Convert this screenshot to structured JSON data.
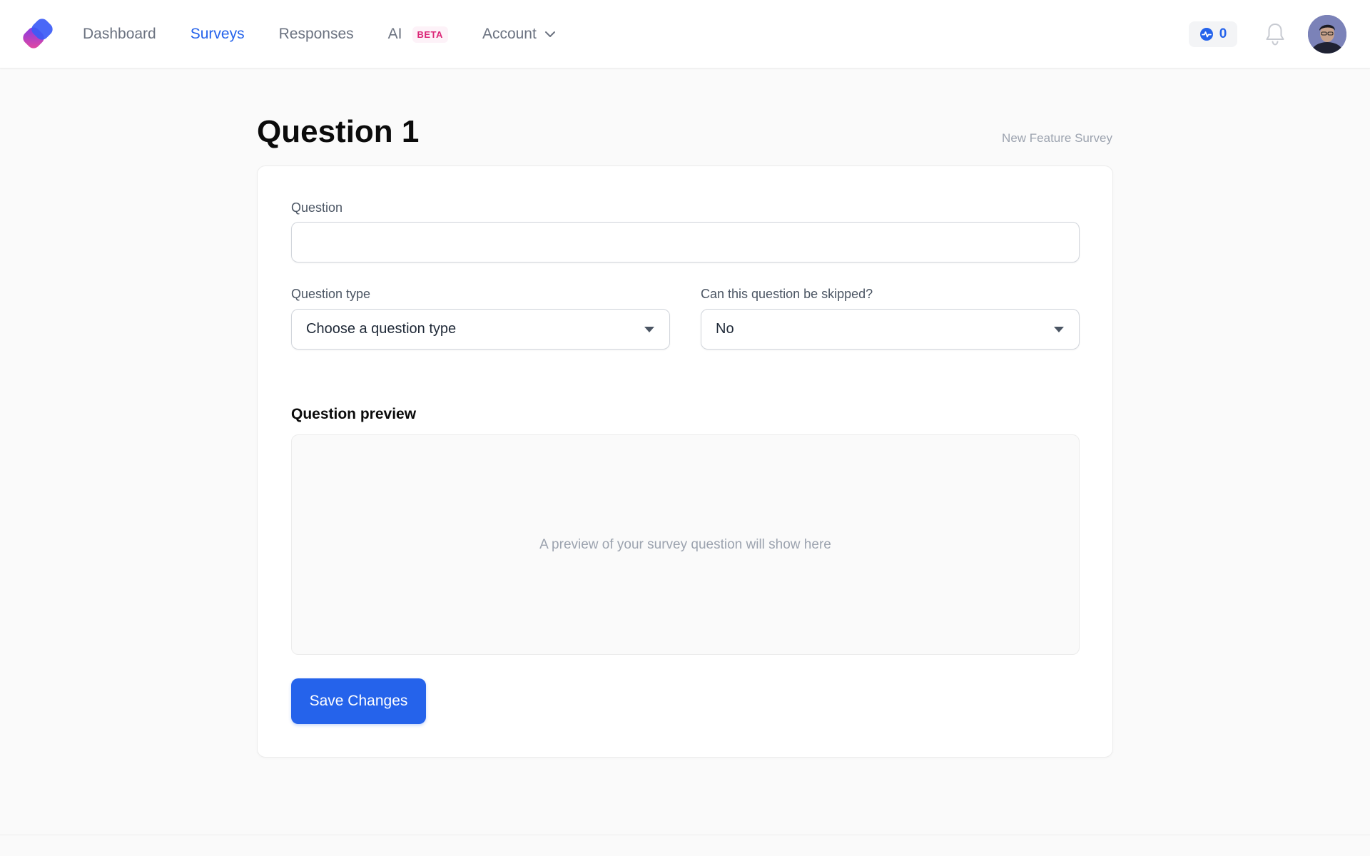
{
  "nav": {
    "items": [
      {
        "label": "Dashboard",
        "active": false
      },
      {
        "label": "Surveys",
        "active": true
      },
      {
        "label": "Responses",
        "active": false
      },
      {
        "label": "AI",
        "active": false,
        "badge": "BETA"
      },
      {
        "label": "Account",
        "active": false,
        "dropdown": true
      }
    ]
  },
  "header": {
    "credits_icon": "activity-badge-icon",
    "credits_count": "0",
    "notifications_icon": "bell-icon",
    "avatar_icon": "user-avatar"
  },
  "page": {
    "title": "Question 1",
    "survey_name": "New Feature Survey"
  },
  "form": {
    "question_label": "Question",
    "question_value": "",
    "question_placeholder": "",
    "type_label": "Question type",
    "type_value": "Choose a question type",
    "skip_label": "Can this question be skipped?",
    "skip_value": "No",
    "preview_heading": "Question preview",
    "preview_placeholder": "A preview of your survey question will show here",
    "save_label": "Save Changes"
  },
  "colors": {
    "accent": "#2563eb",
    "beta_text": "#db2777",
    "background": "#fafafa"
  }
}
